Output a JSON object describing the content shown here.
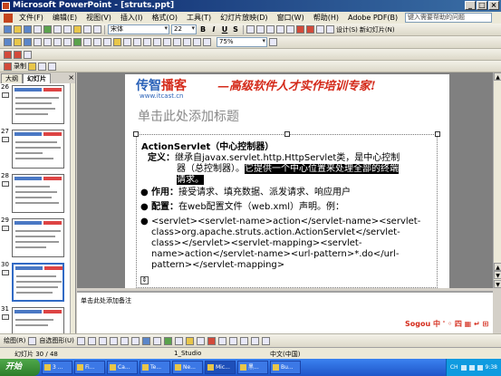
{
  "window": {
    "title": "Microsoft PowerPoint - [struts.ppt]",
    "controls": [
      "_",
      "□",
      "×"
    ]
  },
  "menu": {
    "items": [
      "文件(F)",
      "编辑(E)",
      "视图(V)",
      "插入(I)",
      "格式(O)",
      "工具(T)",
      "幻灯片放映(D)",
      "窗口(W)",
      "帮助(H)",
      "Adobe PDF(B)"
    ],
    "help_placeholder": "键入需要帮助的问题"
  },
  "toolbar_format": {
    "font": "宋体",
    "font_size": "22",
    "bold": "B",
    "italic": "I",
    "underline": "U",
    "shadow": "S",
    "design_label": "设计(S)",
    "new_slide_label": "新幻灯片(N)"
  },
  "toolbar_zoom": {
    "zoom": "75%"
  },
  "toolbar_record": {
    "record_label": "录制"
  },
  "left_pane": {
    "tabs": [
      "大纲",
      "幻灯片"
    ],
    "thumbnails": [
      {
        "num": "26",
        "selected": false
      },
      {
        "num": "27",
        "selected": false
      },
      {
        "num": "28",
        "selected": false
      },
      {
        "num": "29",
        "selected": false
      },
      {
        "num": "30",
        "selected": true
      },
      {
        "num": "31",
        "selected": false
      }
    ]
  },
  "slide": {
    "logo_main": "传智",
    "logo_accent": "播客",
    "logo_url": "www.itcast.cn",
    "slogan": "—高级软件人才实作培训专家!",
    "title_placeholder": "单击此处添加标题",
    "box_title": "ActionServlet（中心控制器）",
    "def_label": "定义：",
    "def_text_a": "继承自javax.servlet.http.HttpServlet类，是中心控制",
    "def_text_b": "器（总控制器）。",
    "def_text_hl": "它提供一个中心位置来处理全部的终端",
    "def_text_hl2": "请求。",
    "role_label": "作用：",
    "role_text": "接受请求、填充数据、派发请求、响应用户",
    "config_label": "配置：",
    "config_text": "在web配置文件（web.xml）声明。例：",
    "code_lines": [
      "<servlet><servlet-name>action</servlet-name><servlet-",
      "class>org.apache.struts.action.ActionServlet</servlet-",
      "class></servlet><servlet-mapping><servlet-",
      "name>action</servlet-name><url-pattern>*.do</url-",
      "pattern></servlet-mapping>"
    ]
  },
  "notes": {
    "placeholder": "单击此处添加备注"
  },
  "ime": {
    "label": "Sogou 中 ' ◦ 四 ▦ ↵ ⊞"
  },
  "drawing_bar": {
    "draw_label": "绘图(R)",
    "autoshapes_label": "自选图形(U)"
  },
  "status_bar": {
    "slide_info": "幻灯片 30 / 48",
    "design_name": "1_Studio",
    "language": "中文(中国)"
  },
  "taskbar": {
    "start_label": "开始",
    "tasks": [
      "3 ...",
      "Fi...",
      "Ca...",
      "Te...",
      "Ne...",
      "Mic...",
      "黑...",
      "Bu..."
    ],
    "tray_time": "9:38",
    "tray_lang": "CH"
  }
}
